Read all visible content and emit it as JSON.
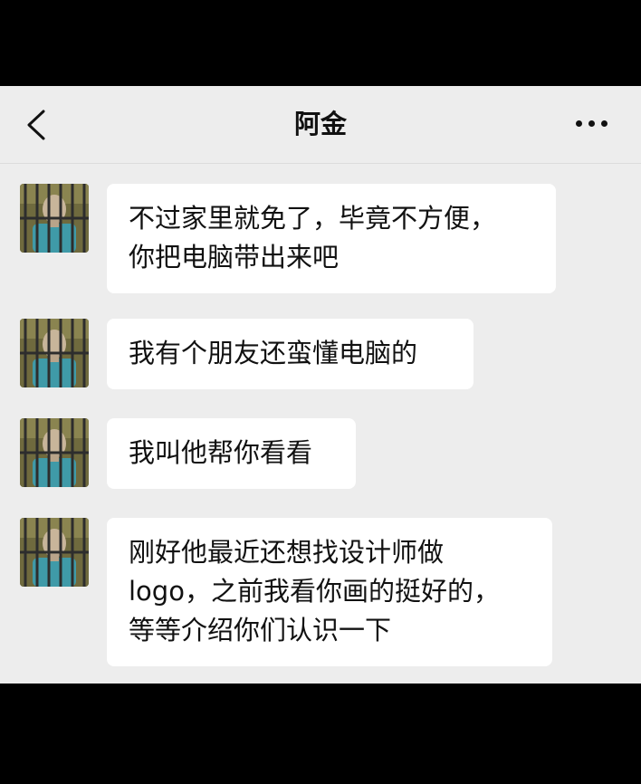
{
  "chat": {
    "title": "阿金"
  },
  "icons": {
    "back": "chevron-left-icon",
    "more": "ellipsis-icon",
    "avatar": "contact-avatar"
  },
  "colors": {
    "background": "#ededed",
    "bubble": "#ffffff",
    "text": "#111111",
    "frame": "#000000"
  },
  "messages": [
    {
      "sender": "阿金",
      "lines": [
        "不过家里就免了，毕竟不方便，",
        "你把电脑带出来吧"
      ]
    },
    {
      "sender": "阿金",
      "lines": [
        "我有个朋友还蛮懂电脑的"
      ]
    },
    {
      "sender": "阿金",
      "lines": [
        "我叫他帮你看看"
      ]
    },
    {
      "sender": "阿金",
      "lines": [
        "刚好他最近还想找设计师做",
        "logo，之前我看你画的挺好的，",
        "等等介绍你们认识一下"
      ]
    }
  ]
}
